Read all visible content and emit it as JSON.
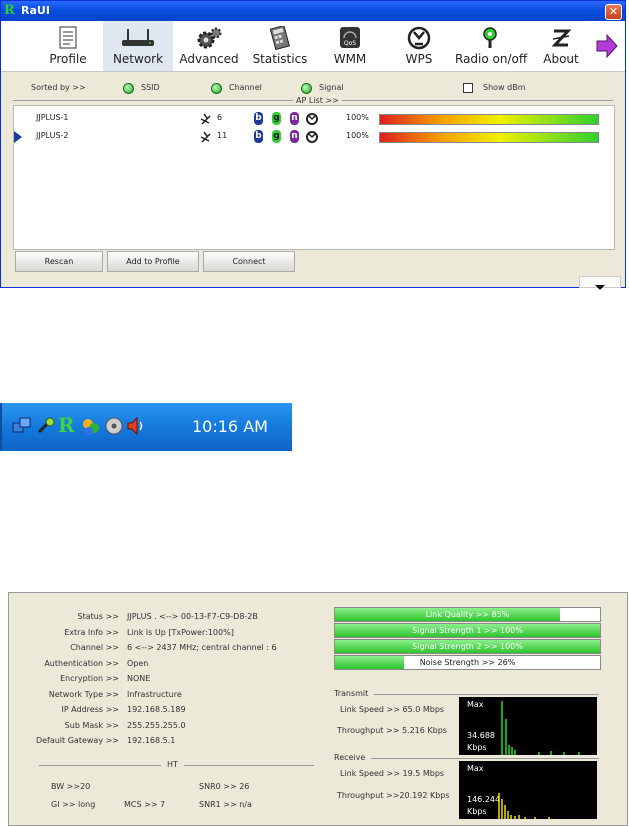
{
  "window": {
    "title": "RaUI",
    "close_symbol": "✕"
  },
  "toolbar": [
    {
      "label": "Profile",
      "icon": "profile-icon"
    },
    {
      "label": "Network",
      "icon": "network-router-icon",
      "active": true
    },
    {
      "label": "Advanced",
      "icon": "advanced-gears-icon"
    },
    {
      "label": "Statistics",
      "icon": "statistics-icon"
    },
    {
      "label": "WMM",
      "icon": "wmm-qos-icon"
    },
    {
      "label": "WPS",
      "icon": "wps-icon"
    },
    {
      "label": "Radio on/off",
      "icon": "radio-icon"
    },
    {
      "label": "About",
      "icon": "about-icon"
    }
  ],
  "sort": {
    "label": "Sorted by >>",
    "ssid": "SSID",
    "channel": "Channel",
    "signal": "Signal",
    "show_dbm": "Show dBm",
    "ap_list": "AP List >>"
  },
  "ap_list": [
    {
      "ssid": "JJPLUS-1",
      "channel": "6",
      "signal": "100%",
      "selected": false
    },
    {
      "ssid": "JJPLUS-2",
      "channel": "11",
      "signal": "100%",
      "selected": true
    }
  ],
  "badges": [
    "b",
    "g",
    "n"
  ],
  "buttons": {
    "rescan": "Rescan",
    "add_profile": "Add to Profile",
    "connect": "Connect"
  },
  "tray": {
    "time": "10:16 AM"
  },
  "status": {
    "rows": [
      {
        "k": "Status >>",
        "v": "JJPLUS . <--> 00-13-F7-C9-D8-2B"
      },
      {
        "k": "Extra Info >>",
        "v": "Link is Up [TxPower:100%]"
      },
      {
        "k": "Channel >>",
        "v": "6 <--> 2437 MHz; central channel : 6"
      },
      {
        "k": "Authentication >>",
        "v": "Open"
      },
      {
        "k": "Encryption >>",
        "v": "NONE"
      },
      {
        "k": "Network Type >>",
        "v": "Infrastructure"
      },
      {
        "k": "IP Address >>",
        "v": "192.168.5.189"
      },
      {
        "k": "Sub Mask >>",
        "v": "255.255.255.0"
      },
      {
        "k": "Default Gateway >>",
        "v": "192.168.5.1"
      }
    ],
    "ht": {
      "title": "HT",
      "bw": "BW >>20",
      "gi": "GI >> long",
      "mcs": "MCS >> 7",
      "snr0": "SNR0 >> 26",
      "snr1": "SNR1 >> n/a"
    },
    "quality": [
      {
        "text": "Link Quality >> 85%",
        "value": 85
      },
      {
        "text": "Signal Strength 1 >> 100%",
        "value": 100
      },
      {
        "text": "Signal Strength 2 >> 100%",
        "value": 100
      },
      {
        "text": "Noise Strength >> 26%",
        "value": 26
      }
    ],
    "transmit": {
      "title": "Transmit",
      "link_speed": "Link Speed >> 65.0 Mbps",
      "throughput": "Throughput >> 5.216 Kbps",
      "max": "Max",
      "graph_value": "34.688",
      "graph_unit": "Kbps"
    },
    "receive": {
      "title": "Receive",
      "link_speed": "Link Speed >> 19.5 Mbps",
      "throughput": "Throughput >>20.192 Kbps",
      "max": "Max",
      "graph_value": "146.244",
      "graph_unit": "Kbps"
    }
  },
  "colors": {
    "badge_b": "#1c3a9c",
    "badge_g": "#2fd02f",
    "badge_n": "#7a2a9a",
    "quality_fill": "#2cc32c",
    "graph_tx": "#22e022",
    "graph_rx": "#f0e000"
  }
}
